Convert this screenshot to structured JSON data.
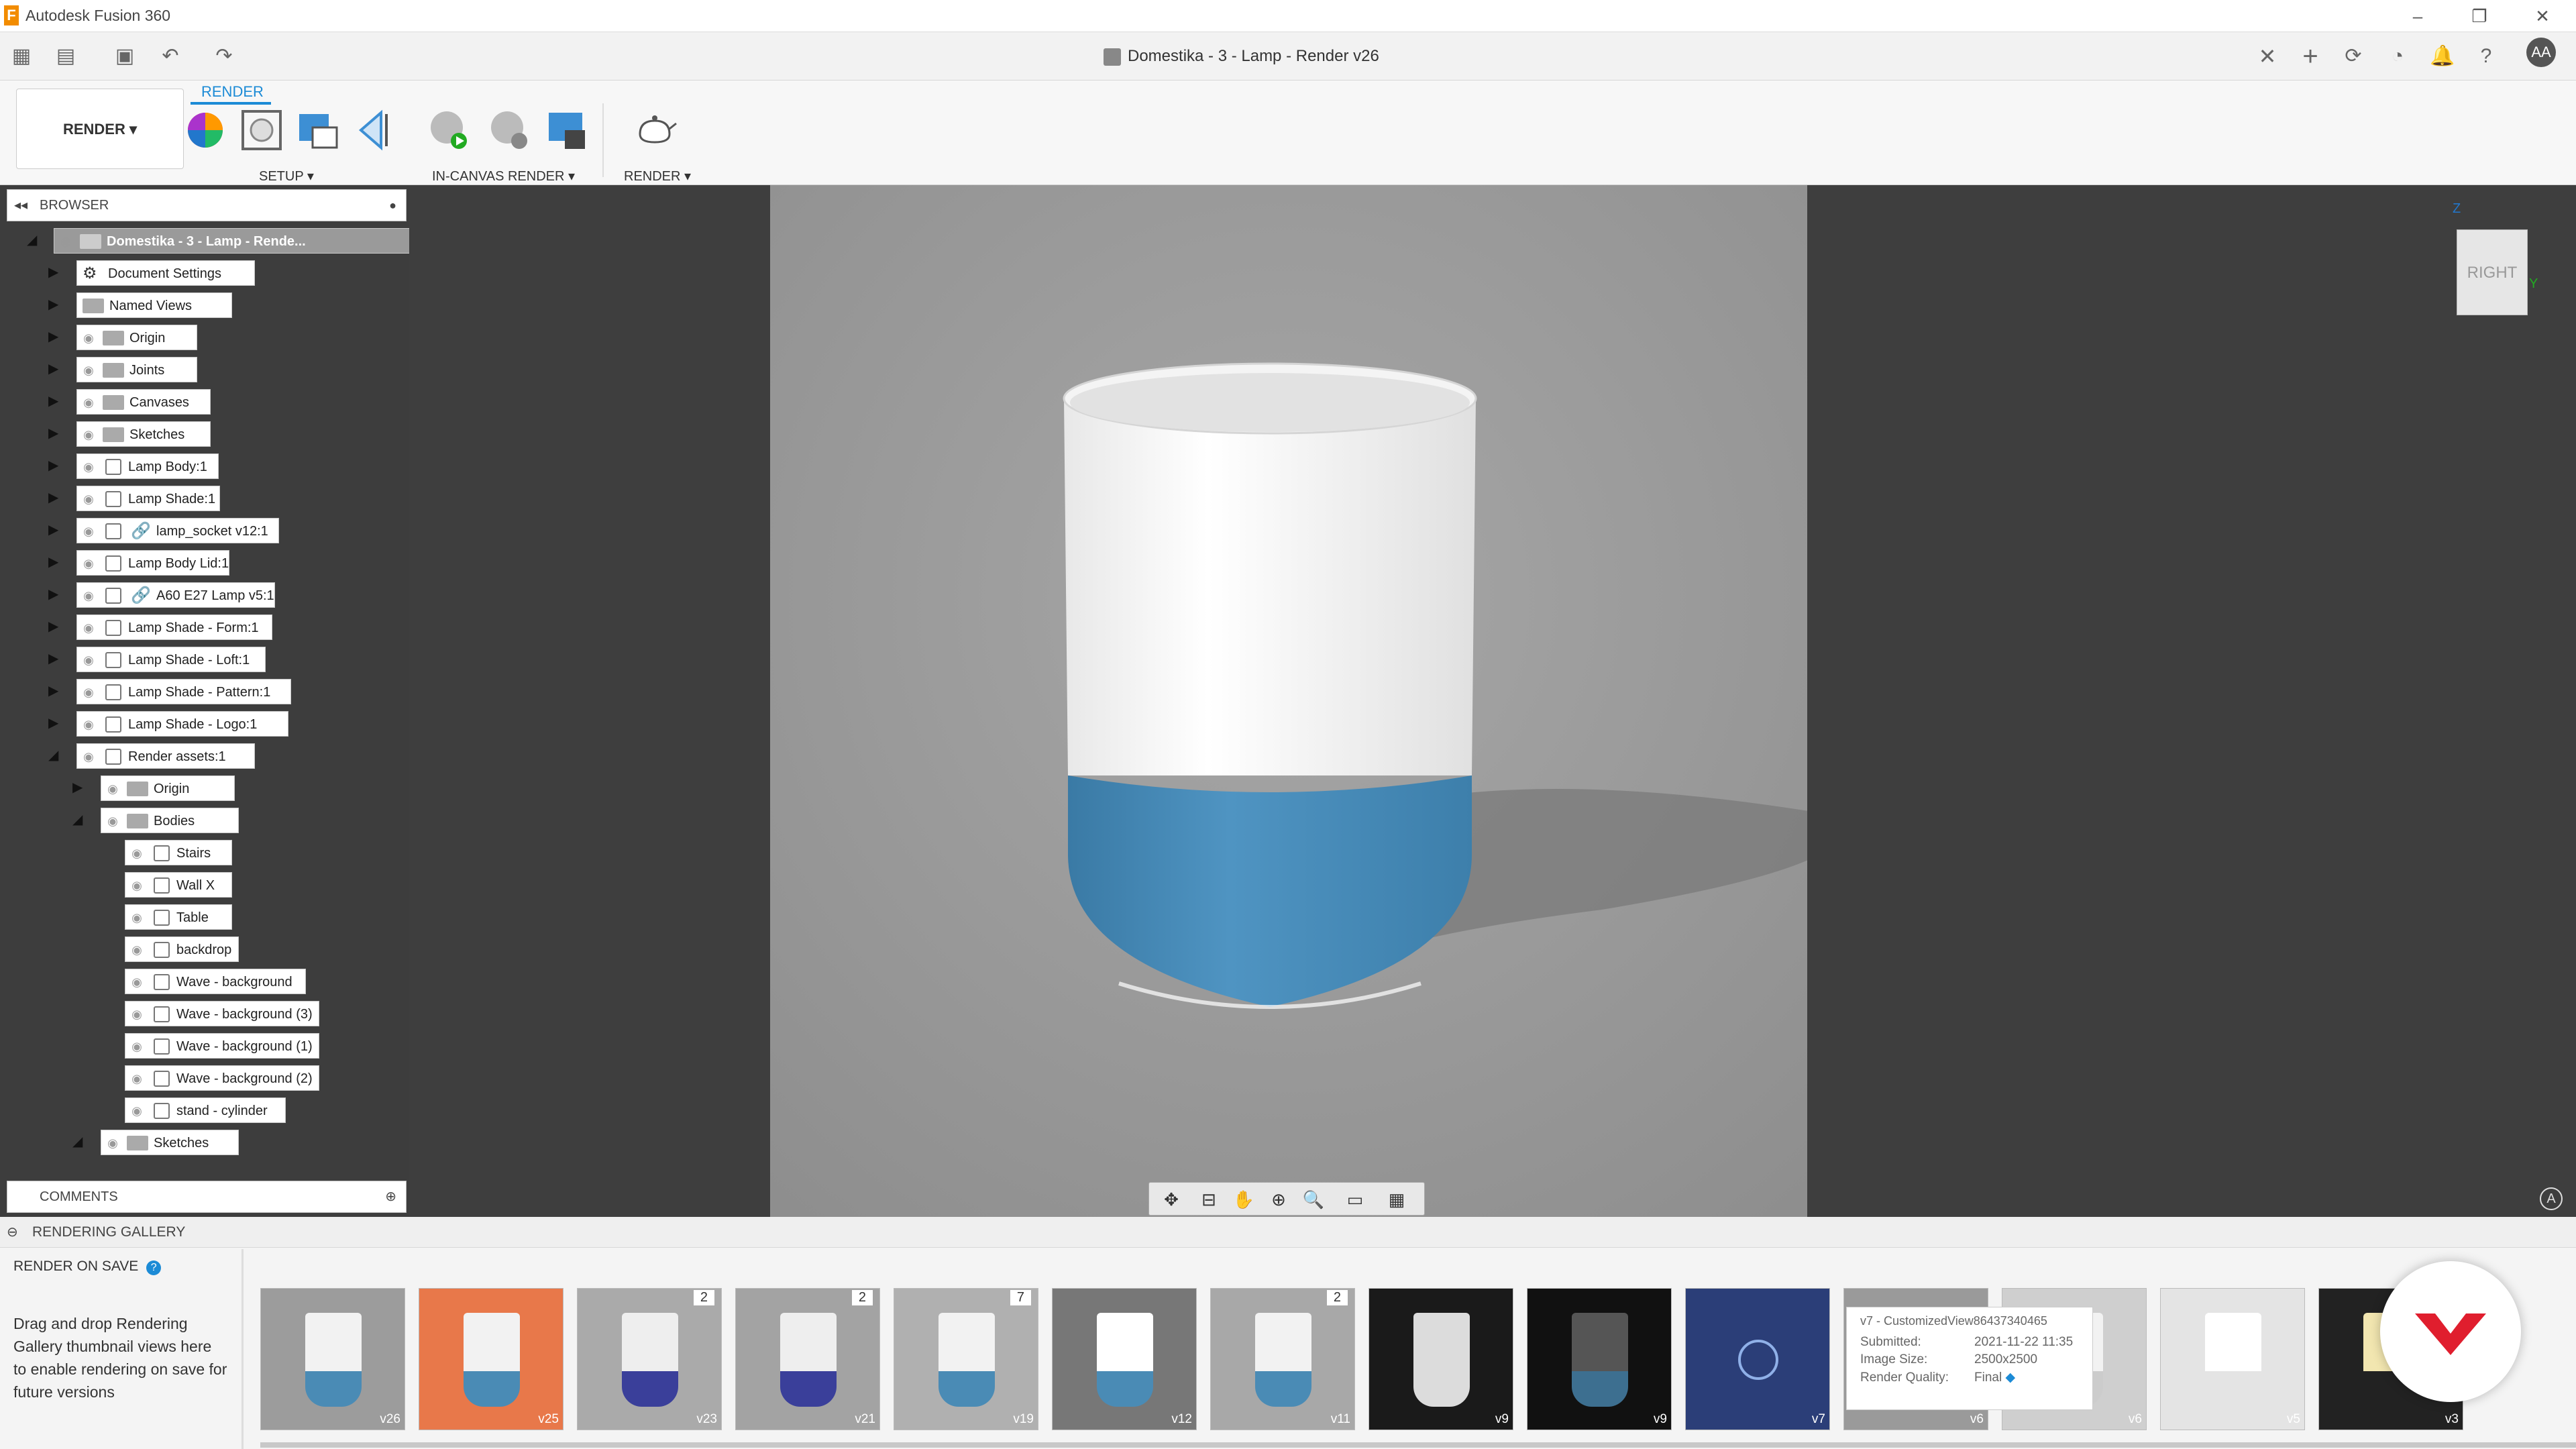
{
  "app": {
    "title": "Autodesk Fusion 360",
    "document_title": "Domestika - 3 - Lamp - Render v26",
    "user_initials": "AA"
  },
  "ribbon": {
    "active_tab": "RENDER",
    "workspace_label": "RENDER ▾",
    "groups": [
      {
        "label": "SETUP ▾"
      },
      {
        "label": "IN-CANVAS RENDER ▾"
      },
      {
        "label": "RENDER ▾"
      }
    ]
  },
  "browser": {
    "header": "BROWSER",
    "root": "Domestika - 3 - Lamp - Rende...",
    "items": [
      {
        "label": "Document Settings",
        "icon": "gear-icon"
      },
      {
        "label": "Named Views",
        "icon": "folder-icon"
      },
      {
        "label": "Origin",
        "icon": "folder-icon"
      },
      {
        "label": "Joints",
        "icon": "folder-icon"
      },
      {
        "label": "Canvases",
        "icon": "folder-icon"
      },
      {
        "label": "Sketches",
        "icon": "folder-icon"
      },
      {
        "label": "Lamp Body:1",
        "icon": "body-icon"
      },
      {
        "label": "Lamp Shade:1",
        "icon": "body-icon"
      },
      {
        "label": "lamp_socket v12:1",
        "icon": "link-icon"
      },
      {
        "label": "Lamp Body Lid:1",
        "icon": "body-icon"
      },
      {
        "label": "A60 E27 Lamp v5:1",
        "icon": "link-icon"
      },
      {
        "label": "Lamp Shade - Form:1",
        "icon": "body-icon"
      },
      {
        "label": "Lamp Shade - Loft:1",
        "icon": "body-icon"
      },
      {
        "label": "Lamp Shade - Pattern:1",
        "icon": "body-icon"
      },
      {
        "label": "Lamp Shade - Logo:1",
        "icon": "body-icon"
      },
      {
        "label": "Render assets:1",
        "icon": "body-icon"
      },
      {
        "label": "Origin",
        "icon": "folder-icon"
      },
      {
        "label": "Bodies",
        "icon": "folder-icon"
      },
      {
        "label": "Stairs",
        "icon": "body-icon"
      },
      {
        "label": "Wall X",
        "icon": "body-icon"
      },
      {
        "label": "Table",
        "icon": "body-icon"
      },
      {
        "label": "backdrop",
        "icon": "body-icon"
      },
      {
        "label": "Wave - background",
        "icon": "body-icon"
      },
      {
        "label": "Wave - background (3)",
        "icon": "body-icon"
      },
      {
        "label": "Wave - background (1)",
        "icon": "body-icon"
      },
      {
        "label": "Wave - background (2)",
        "icon": "body-icon"
      },
      {
        "label": "stand - cylinder",
        "icon": "body-icon"
      },
      {
        "label": "Sketches",
        "icon": "folder-icon"
      }
    ],
    "comments": "COMMENTS"
  },
  "viewcube": {
    "face": "RIGHT"
  },
  "gallery": {
    "header": "RENDERING GALLERY",
    "render_on_save": "RENDER ON SAVE",
    "hint": "Drag and drop Rendering Gallery thumbnail views here to enable rendering on save for future versions",
    "thumbnails": [
      {
        "version": "v26",
        "count": ""
      },
      {
        "version": "v25",
        "count": ""
      },
      {
        "version": "v23",
        "count": "2"
      },
      {
        "version": "v21",
        "count": "2"
      },
      {
        "version": "v19",
        "count": "7"
      },
      {
        "version": "v12",
        "count": ""
      },
      {
        "version": "v11",
        "count": "2"
      },
      {
        "version": "v9",
        "count": ""
      },
      {
        "version": "v9",
        "count": ""
      },
      {
        "version": "v7",
        "count": ""
      },
      {
        "version": "v6",
        "count": ""
      },
      {
        "version": "v6",
        "count": ""
      },
      {
        "version": "v5",
        "count": ""
      },
      {
        "version": "v3",
        "count": ""
      }
    ],
    "tooltip": {
      "title": "v7 - CustomizedView86437340465",
      "submitted_label": "Submitted:",
      "submitted": "2021-11-22 11:35",
      "size_label": "Image Size:",
      "size": "2500x2500",
      "quality_label": "Render Quality:",
      "quality": "Final"
    }
  },
  "colors": {
    "accent": "#1c8bd6",
    "lamp_blue": "#4a8bb5",
    "viewport": "#9a9a9a"
  }
}
